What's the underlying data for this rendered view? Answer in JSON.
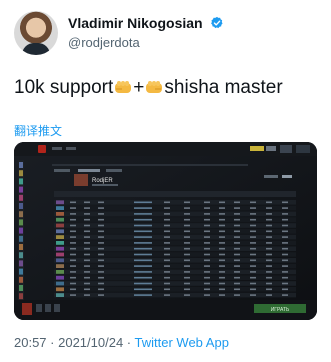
{
  "tweet": {
    "display_name": "Vladimir Nikogosian",
    "handle": "@rodjerdota",
    "text_part1": "10k support",
    "text_plus": "+",
    "text_part2": "shisha master",
    "translate_label": "翻译推文",
    "time": "20:57",
    "separator": " · ",
    "date": "2021/10/24",
    "app": "Twitter Web App"
  },
  "media": {
    "player_name": "RodjER",
    "play_button": "ИГРАТЬ"
  },
  "colors": {
    "link": "#1d9bf0",
    "verified": "#1d9bf0",
    "muted": "#536471"
  }
}
